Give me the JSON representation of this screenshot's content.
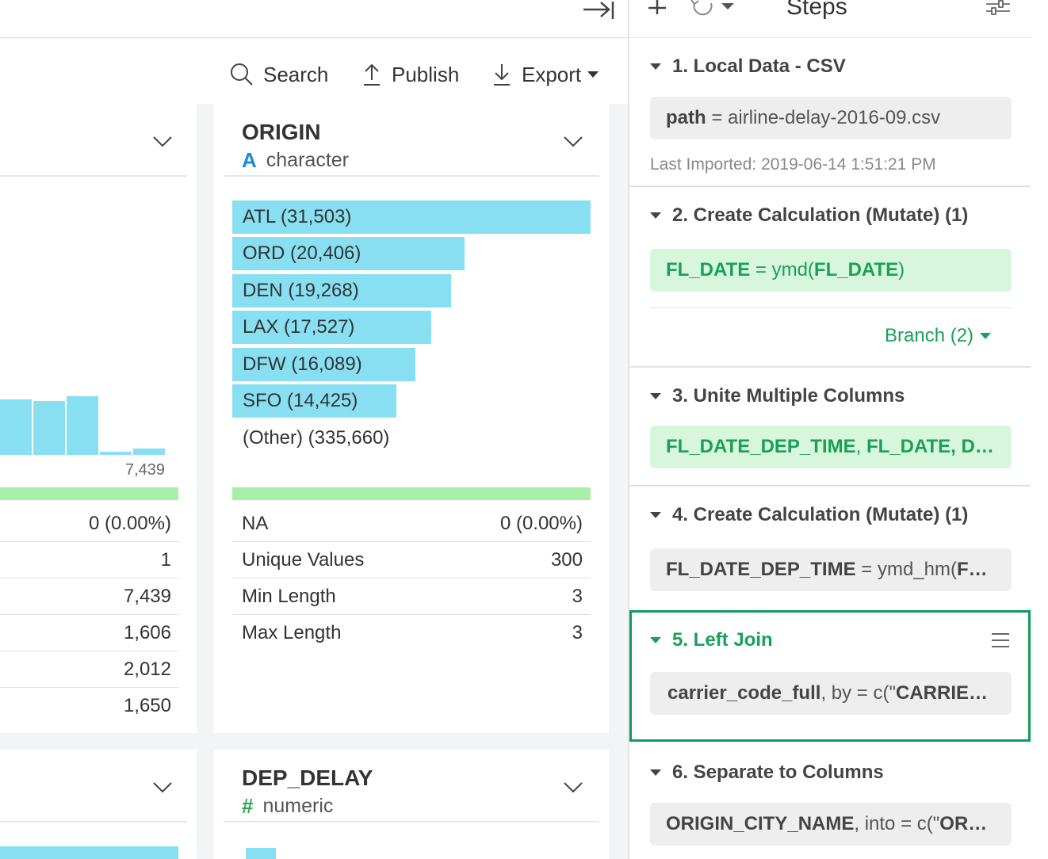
{
  "toolbar": {
    "search_label": "Search",
    "publish_label": "Publish",
    "export_label": "Export"
  },
  "columns": {
    "left_partial": {
      "hist_max_label": "7,439",
      "hist_values": [
        0.88,
        0.85,
        0.93,
        0.05,
        0.1
      ],
      "stats": [
        {
          "value": "0 (0.00%)"
        },
        {
          "value": "1"
        },
        {
          "value": "7,439"
        },
        {
          "value": "1,606"
        },
        {
          "value": "2,012"
        },
        {
          "value": "1,650"
        }
      ]
    },
    "origin": {
      "name": "ORIGIN",
      "type_glyph": "A",
      "type_label": "character",
      "top_values": [
        {
          "label": "ATL (31,503)",
          "count": 31503
        },
        {
          "label": "ORD (20,406)",
          "count": 20406
        },
        {
          "label": "DEN (19,268)",
          "count": 19268
        },
        {
          "label": "LAX (17,527)",
          "count": 17527
        },
        {
          "label": "DFW (16,089)",
          "count": 16089
        },
        {
          "label": "SFO (14,425)",
          "count": 14425
        }
      ],
      "other_label": "(Other) (335,660)",
      "stats": [
        {
          "label": "NA",
          "value": "0 (0.00%)"
        },
        {
          "label": "Unique Values",
          "value": "300"
        },
        {
          "label": "Min Length",
          "value": "3"
        },
        {
          "label": "Max Length",
          "value": "3"
        }
      ]
    },
    "dep_delay": {
      "name": "DEP_DELAY",
      "type_glyph": "#",
      "type_label": "numeric"
    }
  },
  "steps_panel": {
    "title": "Steps",
    "steps": [
      {
        "title": "1. Local Data - CSV",
        "box_key": "path",
        "box_rest": " = airline-delay-2016-09.csv",
        "note": "Last Imported: 2019-06-14 1:51:21 PM"
      },
      {
        "title": "2. Create Calculation (Mutate) (1)",
        "box_key": "FL_DATE",
        "box_rest": " = ymd(",
        "box_key2": "FL_DATE",
        "box_tail": ")",
        "branch": "Branch (2)"
      },
      {
        "title": "3. Unite Multiple Columns",
        "box_key": "FL_DATE_DEP_TIME",
        "box_rest": ", ",
        "box_key2": "FL_DATE",
        "box_tail": ", D…"
      },
      {
        "title": "4. Create Calculation (Mutate) (1)",
        "box_key": "FL_DATE_DEP_TIME",
        "box_rest": " = ymd_hm(",
        "box_key2": "F…",
        "box_tail": ""
      },
      {
        "title": "5. Left Join",
        "box_key": "carrier_code_full",
        "box_rest": ", by = c(\"",
        "box_key2": "CARRIE…",
        "box_tail": ""
      },
      {
        "title": "6. Separate to Columns",
        "box_key": "ORIGIN_CITY_NAME",
        "box_rest": ", into = c(\"",
        "box_key2": "OR…",
        "box_tail": ""
      }
    ]
  },
  "colors": {
    "bar": "#88dff2",
    "na_bar": "#a8f0a9",
    "accent_green": "#19a05a",
    "type_char_blue": "#1e88d8",
    "type_num_green": "#2ba84a"
  }
}
